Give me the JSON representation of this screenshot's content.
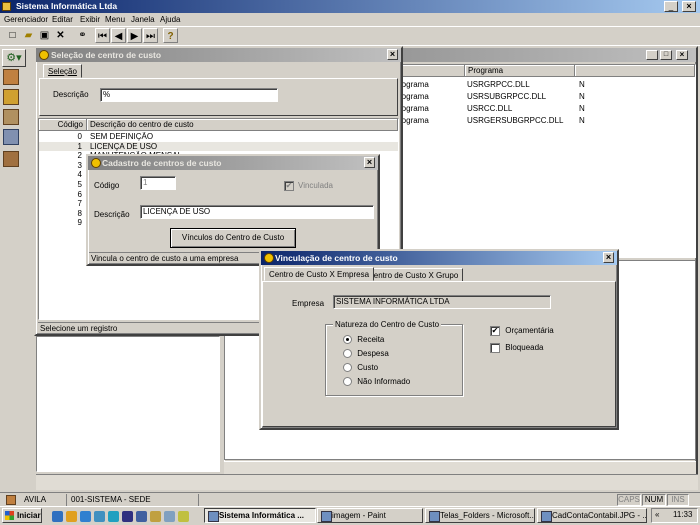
{
  "app": {
    "title": "Sistema Informática Ltda"
  },
  "menu": [
    "Gerenciador",
    "Editar",
    "Exibir",
    "Menu",
    "Janela",
    "Ajuda"
  ],
  "back_window": {
    "columns": [
      "po",
      "Programa"
    ],
    "rows": [
      {
        "type": "rograma",
        "program": "USRGRPCC.DLL",
        "flag": "N"
      },
      {
        "type": "rograma",
        "program": "USRSUBGRPCC.DLL",
        "flag": "N"
      },
      {
        "type": "rograma",
        "program": "USRCC.DLL",
        "flag": "N"
      },
      {
        "type": "rograma",
        "program": "USRGERSUBGRPCC.DLL",
        "flag": "N"
      }
    ]
  },
  "selecao": {
    "title": "Seleção de centro de custo",
    "tab": "Seleção",
    "descricao_label": "Descrição",
    "descricao_value": "%",
    "columns": [
      "Código",
      "Descrição do centro de custo"
    ],
    "rows": [
      {
        "code": "0",
        "desc": "SEM DEFINIÇÃO"
      },
      {
        "code": "1",
        "desc": "LICENÇA DE USO"
      },
      {
        "code": "2",
        "desc": "MANUTENÇÃO MENSAL"
      },
      {
        "code": "3",
        "desc": ""
      },
      {
        "code": "4",
        "desc": ""
      },
      {
        "code": "5",
        "desc": ""
      },
      {
        "code": "6",
        "desc": ""
      },
      {
        "code": "7",
        "desc": ""
      },
      {
        "code": "8",
        "desc": ""
      },
      {
        "code": "9",
        "desc": ""
      }
    ],
    "status": "Selecione um registro"
  },
  "cadastro": {
    "title": "Cadastro de centros de custo",
    "codigo_label": "Código",
    "codigo_value": "1",
    "vinculada_label": "Vinculada",
    "descricao_label": "Descrição",
    "descricao_value": "LICENÇA DE USO",
    "button": "Vínculos do Centro de Custo",
    "status": "Vincula o centro de custo a uma empresa"
  },
  "vinculacao": {
    "title": "Vinculação de centro de custo",
    "tabs": [
      "Centro de Custo X Empresa",
      "Centro de Custo X Grupo"
    ],
    "empresa_label": "Empresa",
    "empresa_value": "SISTEMA INFORMÁTICA LTDA",
    "natureza_label": "Natureza do Centro de Custo",
    "natureza_options": [
      "Receita",
      "Despesa",
      "Custo",
      "Não Informado"
    ],
    "orcamentaria_label": "Orçamentária",
    "bloqueada_label": "Bloqueada"
  },
  "statusbar": {
    "user": "AVILA",
    "system": "001-SISTEMA - SEDE",
    "caps": "CAPS",
    "num": "NUM",
    "ins": "INS"
  },
  "taskbar": {
    "start": "Iniciar",
    "tasks": [
      "Sistema Informática ...",
      "imagem - Paint",
      "Telas_Folders - Microsoft...",
      "CadContaContabil.JPG - ..."
    ],
    "clock": "11:33"
  }
}
